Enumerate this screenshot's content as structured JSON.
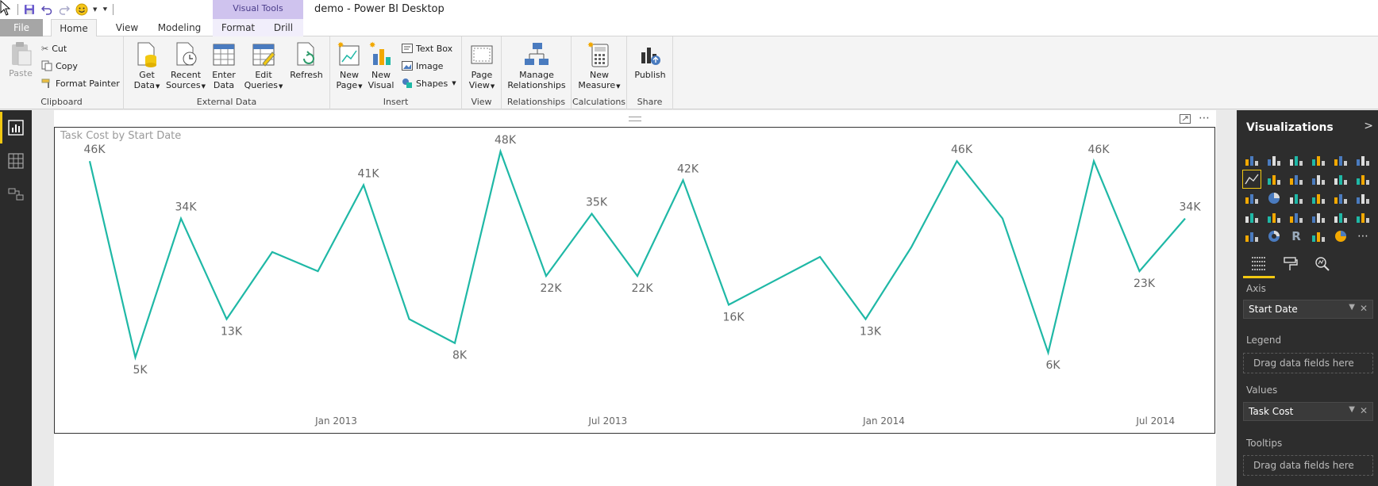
{
  "window": {
    "title": "demo - Power BI Desktop",
    "contextual_group": "Visual Tools"
  },
  "tabs": {
    "file": "File",
    "home": "Home",
    "view": "View",
    "modeling": "Modeling",
    "format": "Format",
    "drill": "Drill"
  },
  "ribbon": {
    "clipboard": {
      "label": "Clipboard",
      "paste": "Paste",
      "cut": "Cut",
      "copy": "Copy",
      "format_painter": "Format Painter"
    },
    "external_data": {
      "label": "External Data",
      "get_data_1": "Get",
      "get_data_2": "Data",
      "recent_sources_1": "Recent",
      "recent_sources_2": "Sources",
      "enter_data_1": "Enter",
      "enter_data_2": "Data",
      "edit_queries_1": "Edit",
      "edit_queries_2": "Queries",
      "refresh": "Refresh"
    },
    "insert": {
      "label": "Insert",
      "new_page_1": "New",
      "new_page_2": "Page",
      "new_visual_1": "New",
      "new_visual_2": "Visual",
      "text_box": "Text Box",
      "image": "Image",
      "shapes": "Shapes"
    },
    "view": {
      "label": "View",
      "page_view_1": "Page",
      "page_view_2": "View"
    },
    "relationships": {
      "label": "Relationships",
      "manage_1": "Manage",
      "manage_2": "Relationships"
    },
    "calculations": {
      "label": "Calculations",
      "new_measure_1": "New",
      "new_measure_2": "Measure"
    },
    "share": {
      "label": "Share",
      "publish": "Publish"
    }
  },
  "visual": {
    "title": "Task Cost by Start Date"
  },
  "chart_data": {
    "type": "line",
    "title": "Task Cost by Start Date",
    "xlabel": "",
    "ylabel": "",
    "x_tick_labels": [
      "Jan 2013",
      "Jul 2013",
      "Jan 2014",
      "Jul 2014"
    ],
    "series": [
      {
        "values": [
          46,
          5,
          34,
          13,
          27,
          23,
          41,
          13,
          8,
          48,
          22,
          35,
          22,
          42,
          16,
          21,
          26,
          13,
          28,
          46,
          34,
          6,
          46,
          23,
          34
        ],
        "labels": [
          "46K",
          "5K",
          "34K",
          "13K",
          "",
          "",
          "41K",
          "",
          "8K",
          "48K",
          "22K",
          "35K",
          "22K",
          "42K",
          "16K",
          "",
          "",
          "13K",
          "",
          "46K",
          "",
          "6K",
          "46K",
          "23K",
          "34K"
        ]
      }
    ],
    "ylim": [
      0,
      50
    ],
    "line_color": "#1fb8a6",
    "grid": false
  },
  "pane": {
    "title": "Visualizations",
    "axis_label": "Axis",
    "axis_field": "Start Date",
    "legend_label": "Legend",
    "legend_placeholder": "Drag data fields here",
    "values_label": "Values",
    "values_field": "Task Cost",
    "tooltips_label": "Tooltips",
    "tooltips_placeholder": "Drag data fields here"
  }
}
